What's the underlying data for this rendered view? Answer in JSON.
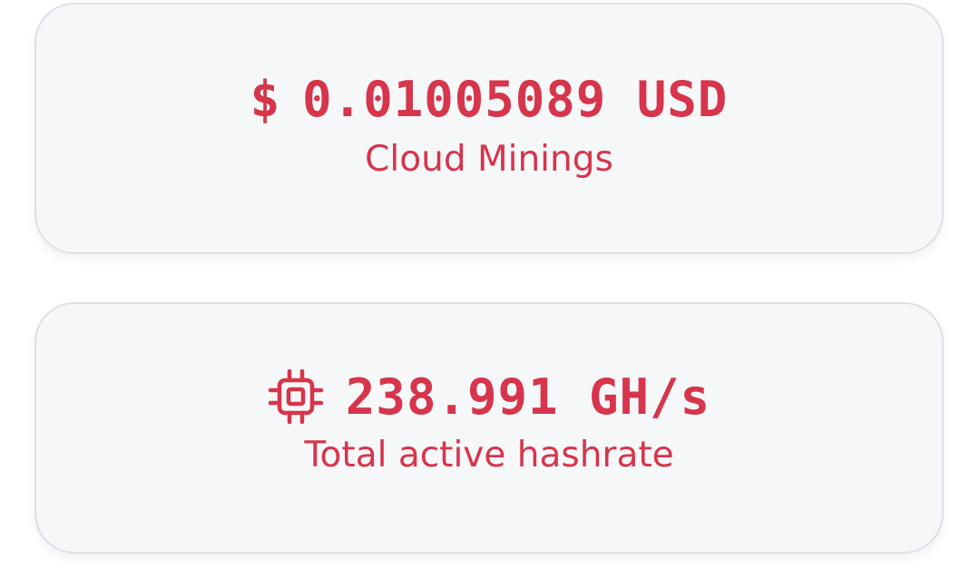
{
  "theme": {
    "accent": "#d6354b",
    "card_background": "#f6f7f9",
    "card_border": "#dde0e8"
  },
  "stats": {
    "balance": {
      "icon": "dollar-icon",
      "icon_glyph": "$",
      "value": "0.01005089 USD",
      "caption": "Cloud Minings"
    },
    "hashrate": {
      "icon": "cpu-chip-icon",
      "value": "238.991 GH/s",
      "caption": "Total active hashrate"
    }
  }
}
